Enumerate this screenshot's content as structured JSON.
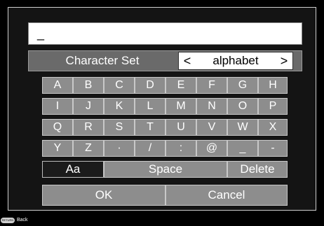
{
  "input": {
    "value": "_"
  },
  "charset": {
    "label": "Character Set",
    "value": "alphabet",
    "prev_arrow": "<",
    "next_arrow": ">"
  },
  "keyboard": {
    "rows": [
      [
        "A",
        "B",
        "C",
        "D",
        "E",
        "F",
        "G",
        "H"
      ],
      [
        "I",
        "J",
        "K",
        "L",
        "M",
        "N",
        "O",
        "P"
      ],
      [
        "Q",
        "R",
        "S",
        "T",
        "U",
        "V",
        "W",
        "X"
      ],
      [
        "Y",
        "Z",
        "·",
        "/",
        ":",
        "@",
        "_",
        "-"
      ]
    ],
    "case_key": "Aa",
    "space_key": "Space",
    "delete_key": "Delete"
  },
  "buttons": {
    "ok": "OK",
    "cancel": "Cancel"
  },
  "footer": {
    "return_icon": "RETURN",
    "back_label": "Back"
  }
}
